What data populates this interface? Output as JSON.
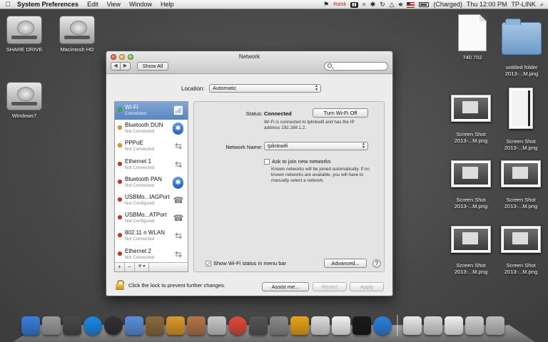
{
  "menubar": {
    "app_name": "System Preferences",
    "menus": [
      "Edit",
      "View",
      "Window",
      "Help"
    ],
    "status": {
      "user_badge": "Rahik",
      "battery_text": "(Charged)",
      "clock": "Thu 12:00 PM",
      "network_name": "TP-LINK"
    }
  },
  "desktop_icons_left": [
    {
      "label": "SHARE DRIVE"
    },
    {
      "label": "Macintosh HD"
    },
    {
      "label": "Windows7"
    }
  ],
  "desktop_icons_right": [
    {
      "label": "740 702"
    },
    {
      "label": "untitled folder\n2013-...M.png"
    },
    {
      "label": "Screen Shot\n2013-...M.png"
    },
    {
      "label": "Screen Shot\n2013-...M.png"
    },
    {
      "label": "Screen Shot\n2013-...M.png"
    },
    {
      "label": "Screen Shot\n2013-...M.png"
    },
    {
      "label": "Screen Shot\n2013-...M.png"
    },
    {
      "label": "Screen Shot\n2013-...M.png"
    }
  ],
  "window": {
    "title": "Network",
    "show_all_label": "Show All",
    "search_placeholder": "",
    "location_label": "Location:",
    "location_value": "Automatic",
    "services": [
      {
        "name": "Wi-Fi",
        "status": "Connected",
        "dot": "#3fbf3a",
        "icon": "wifi-icon",
        "selected": true
      },
      {
        "name": "Bluetooth DUN",
        "status": "Not Connected",
        "dot": "#e8a21f",
        "icon": "bluetooth-icon"
      },
      {
        "name": "PPPoE",
        "status": "Not Connected",
        "dot": "#e8a21f",
        "icon": "arrows-icon"
      },
      {
        "name": "Ethernet 1",
        "status": "Not Connected",
        "dot": "#d6332a",
        "icon": "arrows-icon"
      },
      {
        "name": "Bluetooth PAN",
        "status": "Not Connected",
        "dot": "#d6332a",
        "icon": "bluetooth-icon"
      },
      {
        "name": "USBMo...IAGPort",
        "status": "Not Configured",
        "dot": "#d6332a",
        "icon": "phone-icon"
      },
      {
        "name": "USBMo...ATPort",
        "status": "Not Configured",
        "dot": "#d6332a",
        "icon": "phone-icon"
      },
      {
        "name": "802.11 n WLAN",
        "status": "Not Connected",
        "dot": "#d6332a",
        "icon": "arrows-icon"
      },
      {
        "name": "Ethernet 2",
        "status": "Not Connected",
        "dot": "#d6332a",
        "icon": "arrows-icon"
      }
    ],
    "toolbar": {
      "add": "+",
      "remove": "−",
      "gear": "✲ ▾"
    },
    "detail": {
      "status_label": "Status:",
      "status_value": "Connected",
      "turn_off_label": "Turn Wi-Fi Off",
      "status_note": "Wi-Fi is connected to tplinkwifi and has the IP address 192.168.1.2.",
      "network_name_label": "Network Name:",
      "network_name_value": "tplinkwifi",
      "ask_join_label": "Ask to join new networks",
      "ask_join_note": "Known networks will be joined automatically. If no known networks are available, you will have to manually select a network.",
      "show_status_label": "Show Wi-Fi status in menu bar",
      "advanced_label": "Advanced...",
      "help_label": "?"
    },
    "lock_text": "Click the lock to prevent further changes.",
    "assist_label": "Assist me...",
    "revert_label": "Revert",
    "apply_label": "Apply"
  },
  "dock_items": [
    {
      "name": "finder-icon",
      "color": "#3a7fd8"
    },
    {
      "name": "launchpad-icon",
      "color": "#9a9a9a"
    },
    {
      "name": "mission-control-icon",
      "color": "#4a4a4a"
    },
    {
      "name": "app-store-icon",
      "color": "#1e88e5"
    },
    {
      "name": "dashboard-icon",
      "color": "#333333"
    },
    {
      "name": "mail-icon",
      "color": "#5b8fd9"
    },
    {
      "name": "iphoto-icon",
      "color": "#8b6a3f"
    },
    {
      "name": "pages-icon",
      "color": "#d99a2b"
    },
    {
      "name": "address-book-icon",
      "color": "#b5754a"
    },
    {
      "name": "preview-icon",
      "color": "#c8c8c8"
    },
    {
      "name": "chrome-icon",
      "color": "#e24b3b"
    },
    {
      "name": "facetime-icon",
      "color": "#555555"
    },
    {
      "name": "system-preferences-icon",
      "color": "#8a8a8a"
    },
    {
      "name": "wifi-diagnostics-icon",
      "color": "#e6a41c"
    },
    {
      "name": "migration-icon",
      "color": "#dddddd"
    },
    {
      "name": "x11-icon",
      "color": "#f2f2f2"
    },
    {
      "name": "terminal-icon",
      "color": "#1a1a1a"
    },
    {
      "name": "itunes-icon",
      "color": "#2f7fe0"
    },
    {
      "name": "document-stack-icon",
      "color": "#e9e9e9"
    },
    {
      "name": "window-stack-icon",
      "color": "#d4d4d4"
    },
    {
      "name": "downloads-stack-icon",
      "color": "#f0f0f0"
    },
    {
      "name": "folder-stack-icon",
      "color": "#cfcfcf"
    },
    {
      "name": "trash-icon",
      "color": "#bcbcbc"
    }
  ]
}
